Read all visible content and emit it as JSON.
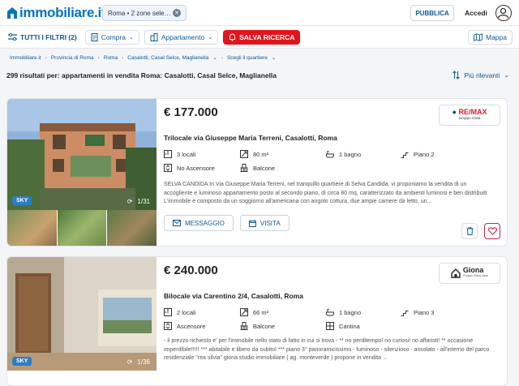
{
  "header": {
    "logo_text": "immobiliare.it",
    "search_chip": "Roma • 2 zone sele…",
    "publish_label": "PUBBLICA",
    "login_label": "Accedi"
  },
  "filters": {
    "all_filters": "TUTTI I FILTRI (2)",
    "contract": "Compra",
    "property_type": "Appartamento",
    "save_search": "SALVA RICERCA",
    "map": "Mappa"
  },
  "breadcrumb": [
    "Immobiliare.it",
    "Provincia di Roma",
    "Roma",
    "Casalotti, Casal Selce, Maglianella",
    "Scegli il quartiere"
  ],
  "results": {
    "summary": "299 risultati per: appartamenti in vendita Roma: Casalotti, Casal Selce, Maglianella",
    "sort_label": "Più rilevanti"
  },
  "listings": [
    {
      "price": "€ 177.000",
      "title": "Trilocale via Giuseppe Maria Terreni, Casalotti, Roma",
      "agency": "RE/MAX",
      "agency_sub": "Gruppo Casa",
      "badge": "SKY",
      "photo_count": "1/31",
      "features": [
        "3 locali",
        "80 m²",
        "1 bagno",
        "Piano 2",
        "No Ascensore",
        "Balcone"
      ],
      "description": "SELVA CANDIDA In Via Giuseppe Maria Terreni, nel tranquillo quartiere di Selva Candida, vi proponiamo la vendita di un accogliente e luminoso appartamento posto al secondo piano, di circa 80 mq, caratterizzato da ambienti luminosi e ben distribuiti. L'immobile è composto da un soggiorno all'americana con angolo cottura, due ampie camere da letto, un...",
      "message_label": "MESSAGGIO",
      "visit_label": "VISITA"
    },
    {
      "price": "€ 240.000",
      "title": "Bilocale via Carentino 2/4, Casalotti, Roma",
      "agency": "Giona",
      "agency_sub": "Gruppo Giona Case",
      "badge": "SKY",
      "photo_count": "1/36",
      "features": [
        "2 locali",
        "66 m²",
        "1 bagno",
        "Piano 3",
        "Ascensore",
        "Balcone",
        "Cantina"
      ],
      "description": "- il prezzo richiesto e' per l'immobile nello stato di fatto in cui si trova - ** no perditempo! no curiosi! no affaristi! ** occasione imperdibile!!!!! *** abitabile e libero da subito! *** piano 3° panoramicissimo - luminoso - silenzioso - assolato - all'interno del parco residenziale \"rea silvia\" giona studio immobiliare ( ag. monteverde ) propone in vendita ..."
    }
  ],
  "colors": {
    "brand_blue": "#0074c1",
    "link_blue": "#0b5a97",
    "save_red": "#e1141e",
    "sky_badge": "#2a7ec2"
  }
}
